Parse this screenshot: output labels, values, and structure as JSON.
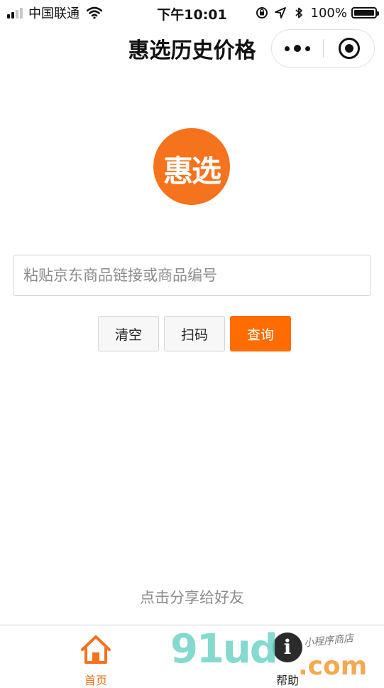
{
  "status_bar": {
    "carrier": "中国联通",
    "time": "下午10:01",
    "battery": "100%"
  },
  "nav": {
    "title": "惠选历史价格"
  },
  "logo": {
    "text": "惠选",
    "color": "#f5731d"
  },
  "search": {
    "value": "",
    "placeholder": "粘贴京东商品链接或商品编号"
  },
  "buttons": {
    "clear": "清空",
    "scan": "扫码",
    "query": "查询",
    "accent": "#ff6c02"
  },
  "share_text": "点击分享给好友",
  "tabbar": {
    "items": [
      {
        "label": "首页",
        "icon": "home-icon",
        "active": true
      },
      {
        "label": "帮助",
        "icon": "help-icon",
        "active": false
      }
    ],
    "active_color": "#f5731d"
  },
  "watermark": {
    "main": "91ud",
    "suffix": ".com",
    "tag": "小程序商店"
  }
}
